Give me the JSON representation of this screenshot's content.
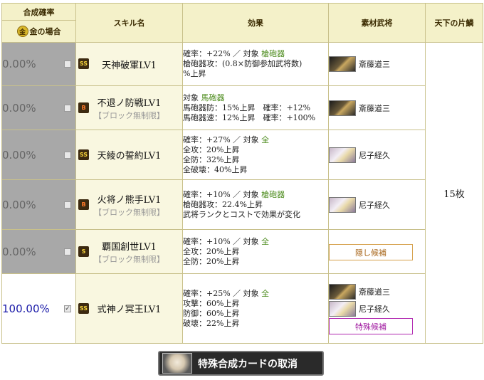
{
  "headers": {
    "rate": "合成確率",
    "gold_case": "金の場合",
    "coin_glyph": "金",
    "skill_name": "スキル名",
    "effect": "効果",
    "material": "素材武将",
    "tenka": "天下の片鱗"
  },
  "rows": [
    {
      "rate": "0.00%",
      "checked": false,
      "rank": "SS",
      "skill": "天神破軍LV1",
      "restriction": "",
      "effect": [
        {
          "text": "確率：+22% ／ 対象 ",
          "target": "槍砲器"
        },
        {
          "text": "槍砲器攻：(0.8×防御参加武将数)",
          "target": ""
        },
        {
          "text": "%上昇",
          "target": ""
        }
      ],
      "materials": [
        {
          "name": "斎藤道三",
          "face": "saito"
        }
      ],
      "button": ""
    },
    {
      "rate": "0.00%",
      "checked": false,
      "rank": "B",
      "skill": "不退ノ防戦LV1",
      "restriction": "【ブロック無制限】",
      "effect": [
        {
          "text": "対象 ",
          "target": "馬砲器"
        },
        {
          "text": "馬砲器防：15%上昇　確率：+12%",
          "target": ""
        },
        {
          "text": "馬砲器速：12%上昇　確率：+100%",
          "target": ""
        }
      ],
      "materials": [
        {
          "name": "斎藤道三",
          "face": "saito"
        }
      ],
      "button": ""
    },
    {
      "rate": "0.00%",
      "checked": false,
      "rank": "SS",
      "skill": "天綾の誓約LV1",
      "restriction": "",
      "effect": [
        {
          "text": "確率：+27% ／ 対象 ",
          "target": "全"
        },
        {
          "text": "全攻：20%上昇",
          "target": ""
        },
        {
          "text": "全防：32%上昇",
          "target": ""
        },
        {
          "text": "全破壊：40%上昇",
          "target": ""
        }
      ],
      "materials": [
        {
          "name": "尼子経久",
          "face": "amago"
        }
      ],
      "button": ""
    },
    {
      "rate": "0.00%",
      "checked": false,
      "rank": "B",
      "skill": "火将ノ熊手LV1",
      "restriction": "【ブロック無制限】",
      "effect": [
        {
          "text": "確率：+10% ／ 対象 ",
          "target": "槍砲器"
        },
        {
          "text": "槍砲器攻：22.4%上昇",
          "target": ""
        },
        {
          "text": "武将ランクとコストで効果が変化",
          "target": ""
        }
      ],
      "materials": [
        {
          "name": "尼子経久",
          "face": "amago"
        }
      ],
      "button": ""
    },
    {
      "rate": "0.00%",
      "checked": false,
      "rank": "S",
      "skill": "覇国創世LV1",
      "restriction": "【ブロック無制限】",
      "effect": [
        {
          "text": "確率：+10% ／ 対象 ",
          "target": "全"
        },
        {
          "text": "全攻：20%上昇",
          "target": ""
        },
        {
          "text": "全防：20%上昇",
          "target": ""
        }
      ],
      "materials": [],
      "button": "隠し候補"
    },
    {
      "rate": "100.00%",
      "checked": true,
      "rank": "SS",
      "skill": "式神ノ冥王LV1",
      "restriction": "",
      "effect": [
        {
          "text": "確率：+25% ／ 対象 ",
          "target": "全"
        },
        {
          "text": "攻撃：60%上昇",
          "target": ""
        },
        {
          "text": "防御：60%上昇",
          "target": ""
        },
        {
          "text": "破壊：22%上昇",
          "target": ""
        }
      ],
      "materials": [
        {
          "name": "斎藤道三",
          "face": "saito"
        },
        {
          "name": "尼子経久",
          "face": "amago"
        }
      ],
      "button": "特殊候補"
    }
  ],
  "tenka_count": "15枚",
  "cancel_button": "特殊合成カードの取消"
}
